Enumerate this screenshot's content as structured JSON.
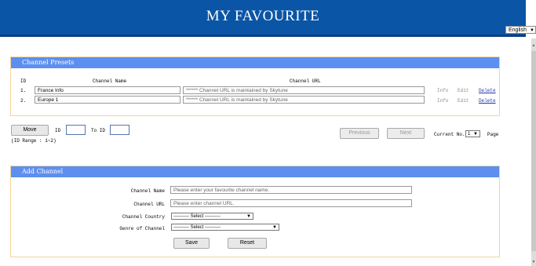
{
  "header": {
    "title": "MY FAVOURITE"
  },
  "language": {
    "selected": "English"
  },
  "presets": {
    "title": "Channel Presets",
    "col_id": "ID",
    "col_name": "Channel Name",
    "col_url": "Channel URL",
    "rows": [
      {
        "num": "1.",
        "name": "France Info",
        "url": "****** Channel URL is maintained by Skytune",
        "info": "Info",
        "edit": "Edit",
        "delete": "Delete"
      },
      {
        "num": "2.",
        "name": "Europe 1",
        "url": "****** Channel URL is maintained by Skytune",
        "info": "Info",
        "edit": "Edit",
        "delete": "Delete"
      }
    ]
  },
  "move": {
    "button": "Move",
    "id_label": "ID",
    "to_label": "To ID",
    "range": "(ID Range : 1~2)"
  },
  "pager": {
    "previous": "Previous",
    "next": "Next",
    "current_label": "Current No.",
    "current_value": "1",
    "page_label": "Page"
  },
  "add": {
    "title": "Add Channel",
    "name_label": "Channel Name",
    "name_placeholder": "Please enter your favourite channel name.",
    "url_label": "Channel URL",
    "url_placeholder": "Please enter channel URL.",
    "country_label": "Channel Country",
    "country_value": "---------- Select ----------",
    "genre_label": "Genre of Channel",
    "genre_value": "---------- Select ----------",
    "save": "Save",
    "reset": "Reset"
  }
}
